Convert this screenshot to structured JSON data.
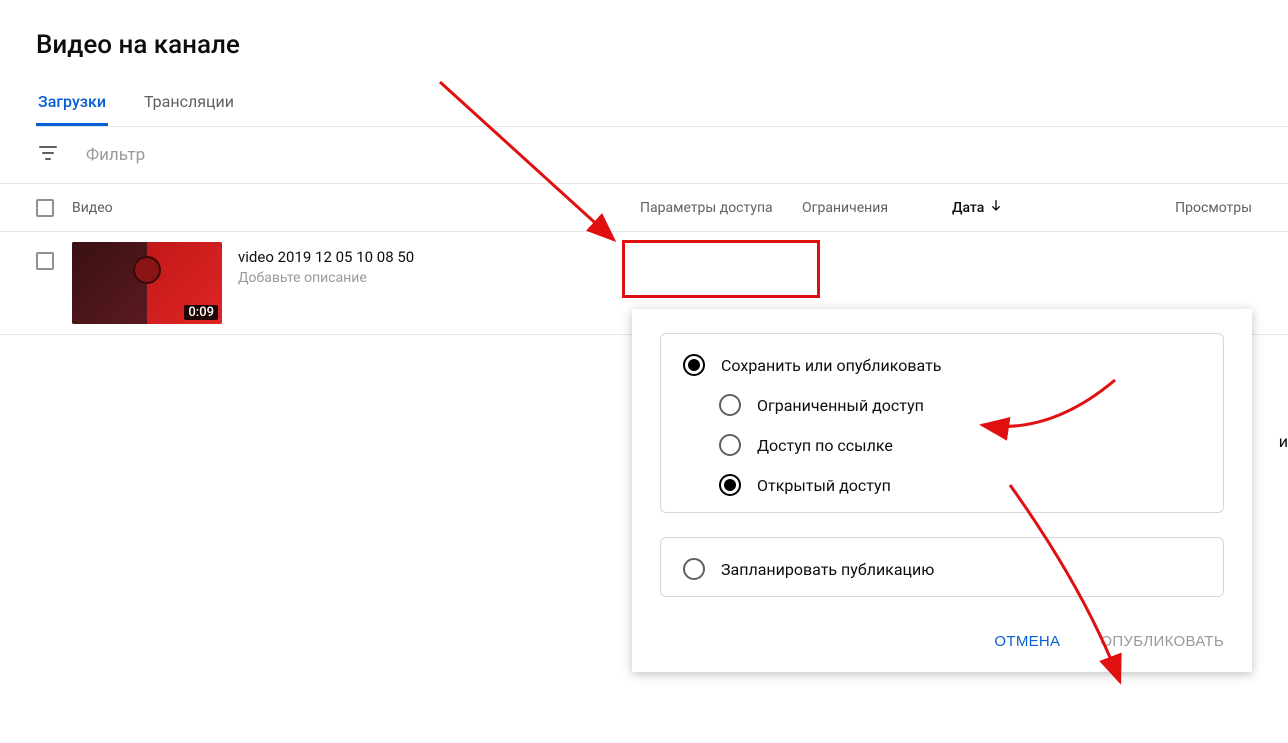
{
  "page": {
    "title": "Видео на канале"
  },
  "tabs": {
    "uploads": "Загрузки",
    "streams": "Трансляции"
  },
  "filter": {
    "placeholder": "Фильтр"
  },
  "columns": {
    "video": "Видео",
    "access": "Параметры доступа",
    "restrictions": "Ограничения",
    "date": "Дата",
    "views": "Просмотры"
  },
  "video": {
    "title": "video 2019 12 05 10 08 50",
    "description_placeholder": "Добавьте описание",
    "duration": "0:09"
  },
  "dropdown": {
    "save_or_publish": "Сохранить или опубликовать",
    "private": "Ограниченный доступ",
    "unlisted": "Доступ по ссылке",
    "public": "Открытый доступ",
    "schedule": "Запланировать публикацию",
    "cancel": "ОТМЕНА",
    "publish": "ОПУБЛИКОВАТЬ"
  },
  "misc": {
    "trailing": "и"
  },
  "colors": {
    "annotation": "#e11010",
    "accent": "#065fd4"
  }
}
